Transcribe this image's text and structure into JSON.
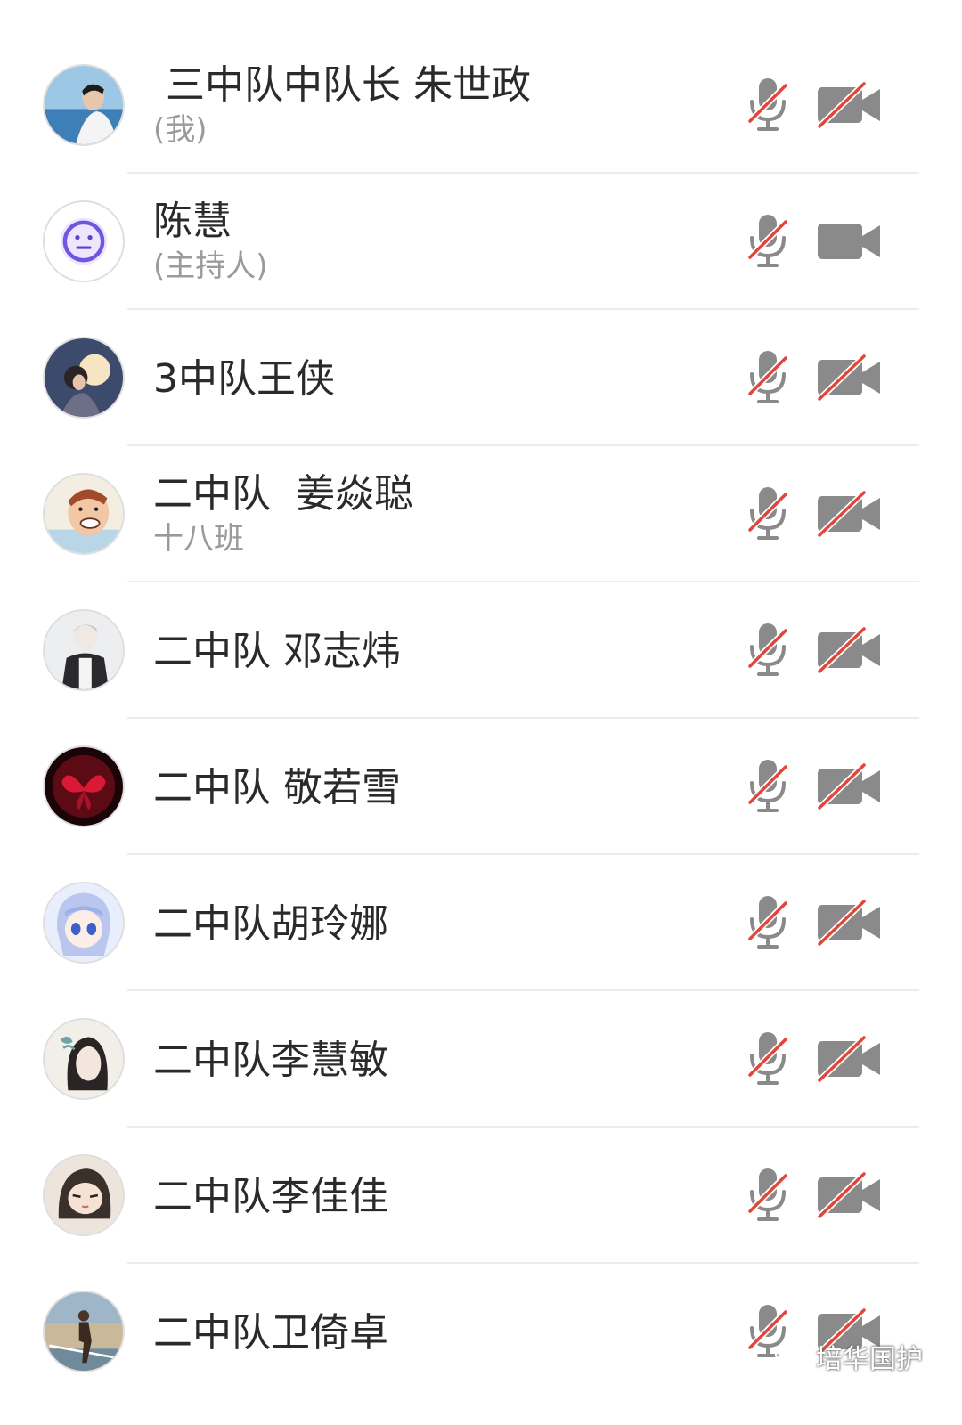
{
  "colors": {
    "icon_gray": "#8a8a8a",
    "slash_red": "#e0463c",
    "divider": "#ececec",
    "text": "#2a2a2a",
    "subtext": "#9a9a9a"
  },
  "participants": [
    {
      "name": " 三中队中队长 朱世政",
      "sub": "(我)",
      "avatar": "photo-sea",
      "mic_muted": true,
      "camera_off": true
    },
    {
      "name": "陈慧",
      "sub": "(主持人)",
      "avatar": "purple-face",
      "mic_muted": true,
      "camera_off": false
    },
    {
      "name": "3中队王侠",
      "sub": "",
      "avatar": "photo-moon",
      "mic_muted": true,
      "camera_off": true
    },
    {
      "name": "二中队  姜焱聪",
      "sub": "十八班",
      "avatar": "cartoon-face",
      "mic_muted": true,
      "camera_off": true
    },
    {
      "name": "二中队 邓志炜",
      "sub": "",
      "avatar": "sketch-boy",
      "mic_muted": true,
      "camera_off": true
    },
    {
      "name": "二中队 敬若雪",
      "sub": "",
      "avatar": "red-butterfly",
      "mic_muted": true,
      "camera_off": true
    },
    {
      "name": "二中队胡玲娜",
      "sub": "",
      "avatar": "anime-girl",
      "mic_muted": true,
      "camera_off": true
    },
    {
      "name": "二中队李慧敏",
      "sub": "",
      "avatar": "drawing-girl",
      "mic_muted": true,
      "camera_off": true
    },
    {
      "name": "二中队李佳佳",
      "sub": "",
      "avatar": "drawing-portrait",
      "mic_muted": true,
      "camera_off": true
    },
    {
      "name": "二中队卫倚卓",
      "sub": "",
      "avatar": "photo-runner",
      "mic_muted": true,
      "camera_off": true
    }
  ],
  "watermark": {
    "text": "培华国护",
    "icon": "wechat-icon"
  }
}
